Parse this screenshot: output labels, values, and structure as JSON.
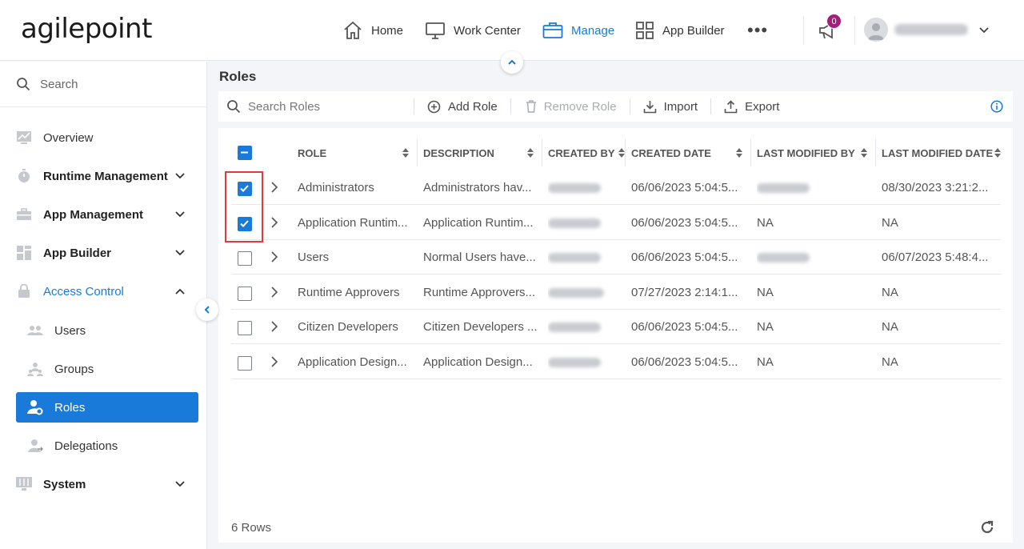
{
  "app": {
    "logo": "agilepoint"
  },
  "nav": {
    "home": "Home",
    "work_center": "Work Center",
    "manage": "Manage",
    "app_builder": "App Builder",
    "more": "•••",
    "notification_count": "0"
  },
  "sidebar": {
    "search_placeholder": "Search",
    "items": [
      {
        "label": "Overview"
      },
      {
        "label": "Runtime Management"
      },
      {
        "label": "App Management"
      },
      {
        "label": "App Builder"
      },
      {
        "label": "Access Control"
      },
      {
        "label": "Users"
      },
      {
        "label": "Groups"
      },
      {
        "label": "Roles"
      },
      {
        "label": "Delegations"
      },
      {
        "label": "System"
      }
    ]
  },
  "page": {
    "title": "Roles"
  },
  "toolbar": {
    "search_placeholder": "Search Roles",
    "add_role": "Add Role",
    "remove_role": "Remove Role",
    "import": "Import",
    "export": "Export"
  },
  "table": {
    "columns": [
      "ROLE",
      "DESCRIPTION",
      "CREATED BY",
      "CREATED DATE",
      "LAST MODIFIED BY",
      "LAST MODIFIED DATE"
    ],
    "rows": [
      {
        "checked": true,
        "role": "Administrators",
        "description": "Administrators hav...",
        "created_date": "06/06/2023 5:04:5...",
        "last_modified_by": "",
        "last_modified_date": "08/30/2023 3:21:2..."
      },
      {
        "checked": true,
        "role": "Application Runtim...",
        "description": "Application Runtim...",
        "created_date": "06/06/2023 5:04:5...",
        "last_modified_by": "NA",
        "last_modified_date": "NA"
      },
      {
        "checked": false,
        "role": "Users",
        "description": "Normal Users have...",
        "created_date": "06/06/2023 5:04:5...",
        "last_modified_by": "",
        "last_modified_date": "06/07/2023 5:48:4..."
      },
      {
        "checked": false,
        "role": "Runtime Approvers",
        "description": "Runtime Approvers...",
        "created_date": "07/27/2023 2:14:1...",
        "last_modified_by": "NA",
        "last_modified_date": "NA"
      },
      {
        "checked": false,
        "role": "Citizen Developers",
        "description": "Citizen Developers ...",
        "created_date": "06/06/2023 5:04:5...",
        "last_modified_by": "NA",
        "last_modified_date": "NA"
      },
      {
        "checked": false,
        "role": "Application Design...",
        "description": "Application Design...",
        "created_date": "06/06/2023 5:04:5...",
        "last_modified_by": "NA",
        "last_modified_date": "NA"
      }
    ]
  },
  "footer": {
    "rows_count": "6 Rows"
  },
  "colors": {
    "accent": "#1a7ad9",
    "highlight": "#e03a3a",
    "badge": "#a0207b"
  }
}
